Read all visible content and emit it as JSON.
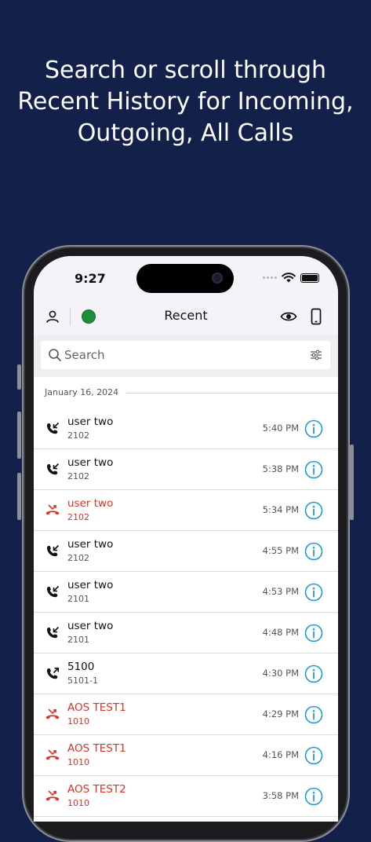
{
  "headline": {
    "line1": "Search or scroll through",
    "line2": "Recent History for Incoming,",
    "line3": "Outgoing, All Calls"
  },
  "status_bar": {
    "time": "9:27"
  },
  "app_bar": {
    "title": "Recent",
    "left_icon": "person-icon",
    "status_color": "#1e8e3e",
    "right_icons": [
      "eye-icon",
      "phone-device-icon"
    ]
  },
  "search": {
    "placeholder": "Search",
    "value": ""
  },
  "date_header": "January 16, 2024",
  "colors": {
    "background": "#13214a",
    "missed": "#d9342b",
    "info_accent": "#1e9bd7"
  },
  "calls": [
    {
      "name": "user two",
      "number": "2102",
      "time": "5:40 PM",
      "type": "incoming"
    },
    {
      "name": "user two",
      "number": "2102",
      "time": "5:38 PM",
      "type": "incoming"
    },
    {
      "name": "user two",
      "number": "2102",
      "time": "5:34 PM",
      "type": "missed"
    },
    {
      "name": "user two",
      "number": "2102",
      "time": "4:55 PM",
      "type": "incoming"
    },
    {
      "name": "user two",
      "number": "2101",
      "time": "4:53 PM",
      "type": "incoming"
    },
    {
      "name": "user two",
      "number": "2101",
      "time": "4:48 PM",
      "type": "incoming"
    },
    {
      "name": "5100",
      "number": "5101-1",
      "time": "4:30 PM",
      "type": "outgoing"
    },
    {
      "name": "AOS TEST1",
      "number": "1010",
      "time": "4:29 PM",
      "type": "missed"
    },
    {
      "name": "AOS TEST1",
      "number": "1010",
      "time": "4:16 PM",
      "type": "missed"
    },
    {
      "name": "AOS  TEST2",
      "number": "1010",
      "time": "3:58 PM",
      "type": "missed"
    }
  ]
}
